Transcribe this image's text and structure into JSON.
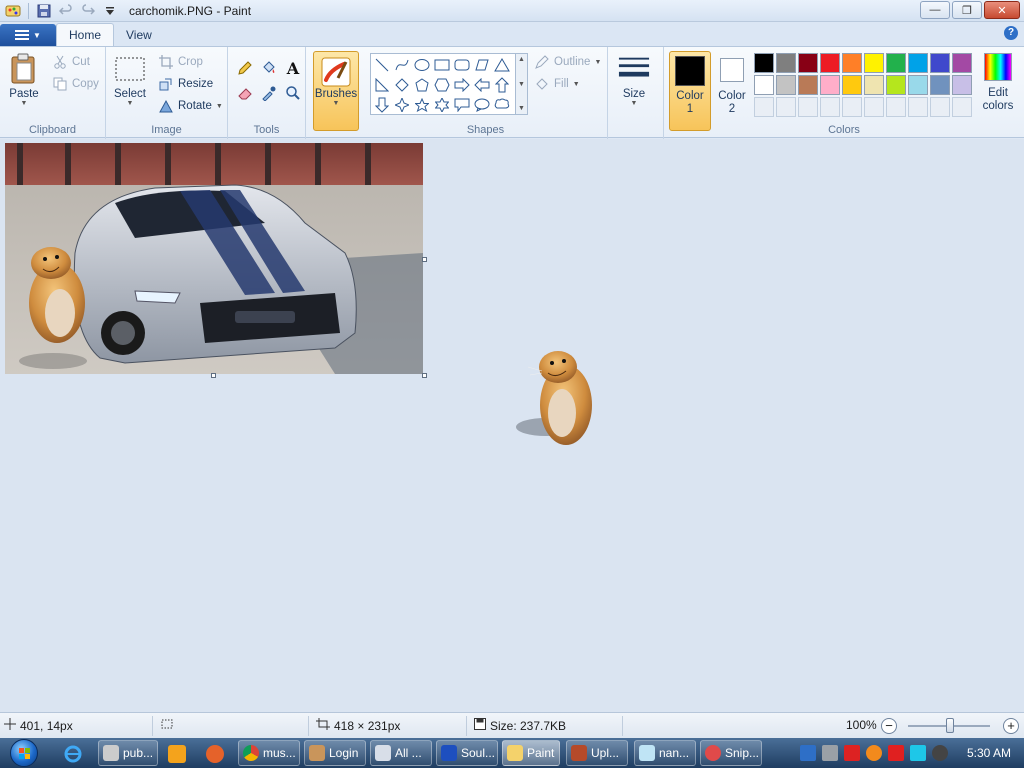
{
  "window": {
    "title": "carchomik.PNG - Paint"
  },
  "tabs": {
    "home": "Home",
    "view": "View"
  },
  "ribbon": {
    "clipboard": {
      "label": "Clipboard",
      "paste": "Paste",
      "cut": "Cut",
      "copy": "Copy"
    },
    "image": {
      "label": "Image",
      "select": "Select",
      "crop": "Crop",
      "resize": "Resize",
      "rotate": "Rotate"
    },
    "tools": {
      "label": "Tools"
    },
    "brushes": {
      "label": "Brushes"
    },
    "shapes": {
      "label": "Shapes",
      "outline": "Outline",
      "fill": "Fill"
    },
    "size": {
      "label": "Size"
    },
    "colors": {
      "label": "Colors",
      "color1": "Color 1",
      "color2": "Color 2",
      "color1_value": "#000000",
      "color2_value": "#ffffff",
      "edit": "Edit colors",
      "palette_row1": [
        "#000000",
        "#7f7f7f",
        "#880015",
        "#ed1c24",
        "#ff7f27",
        "#fff200",
        "#22b14c",
        "#00a2e8",
        "#3f48cc",
        "#a349a4"
      ],
      "palette_row2": [
        "#ffffff",
        "#c3c3c3",
        "#b97a57",
        "#ffaec9",
        "#ffc90e",
        "#efe4b0",
        "#b5e61d",
        "#99d9ea",
        "#7092be",
        "#c8bfe7"
      ]
    }
  },
  "status": {
    "cursor_pos": "401, 14px",
    "selection_size": "",
    "image_size": "418 × 231px",
    "file_size": "Size: 237.7KB",
    "zoom": "100%"
  },
  "taskbar": {
    "items": [
      "pub...",
      "mus...",
      "Login",
      "All ...",
      "Soul...",
      "Paint",
      "Upl...",
      "nan...",
      "Snip..."
    ],
    "clock": "5:30 AM"
  }
}
